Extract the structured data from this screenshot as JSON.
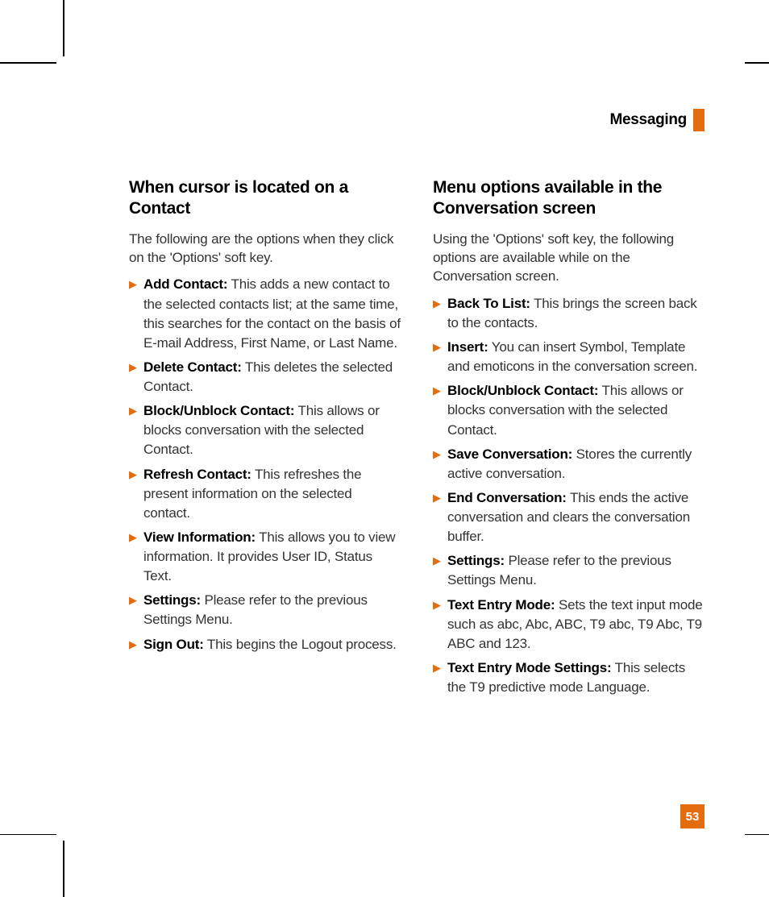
{
  "header": {
    "title": "Messaging"
  },
  "page_number": "53",
  "left": {
    "heading": "When cursor is located on a Contact",
    "intro": "The following are the options when they click on the 'Options' soft key.",
    "items": [
      {
        "label": "Add Contact:",
        "text": " This adds a new contact to the selected contacts list; at the same time, this searches for the contact on the basis of E-mail Address, First Name, or Last Name."
      },
      {
        "label": "Delete Contact:",
        "text": " This deletes the selected Contact."
      },
      {
        "label": "Block/Unblock Contact:",
        "text": " This allows or blocks conversation with the selected Contact."
      },
      {
        "label": "Refresh Contact:",
        "text": " This refreshes the present information on the selected contact."
      },
      {
        "label": "View Information:",
        "text": " This allows you to view information. It provides User ID, Status Text."
      },
      {
        "label": "Settings:",
        "text": " Please refer to the previous Settings Menu."
      },
      {
        "label": "Sign Out:",
        "text": " This begins the Logout process."
      }
    ]
  },
  "right": {
    "heading": "Menu options available in the Conversation screen",
    "intro": "Using the 'Options' soft key, the following options are available while on the Conversation screen.",
    "items": [
      {
        "label": "Back To List:",
        "text": " This brings the screen back to the contacts."
      },
      {
        "label": "Insert:",
        "text": " You can insert Symbol, Template and emoticons in the conversation screen."
      },
      {
        "label": "Block/Unblock Contact:",
        "text": " This allows or blocks conversation with the selected Contact."
      },
      {
        "label": "Save Conversation:",
        "text": " Stores the currently active conversation."
      },
      {
        "label": "End Conversation:",
        "text": " This ends the active conversation and clears the conversation buffer."
      },
      {
        "label": "Settings:",
        "text": " Please refer to the previous Settings Menu."
      },
      {
        "label": "Text Entry Mode:",
        "text": " Sets the text input mode such as abc, Abc, ABC, T9 abc, T9 Abc, T9 ABC and 123."
      },
      {
        "label": "Text Entry Mode Settings:",
        "text": " This selects the T9 predictive mode Language."
      }
    ]
  }
}
